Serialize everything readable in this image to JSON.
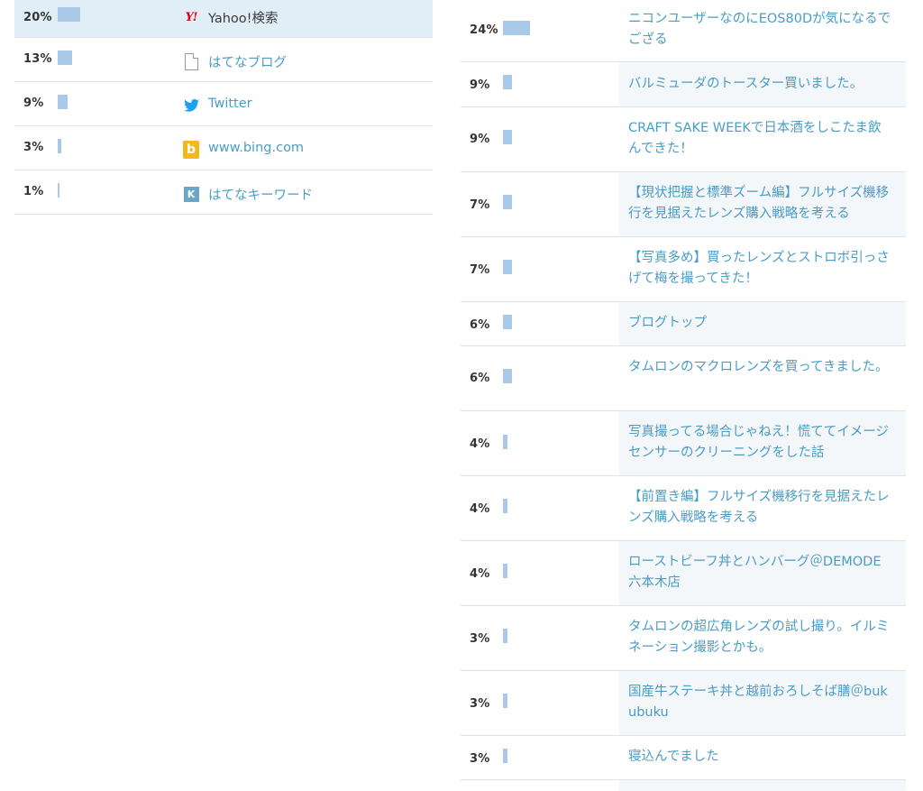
{
  "referrers": [
    {
      "percent": "20%",
      "share": 20,
      "label": "Yahoo!検索",
      "icon": "yahoo-icon",
      "highlighted": true
    },
    {
      "percent": "13%",
      "share": 13,
      "label": "はてなブログ",
      "icon": "document-icon"
    },
    {
      "percent": "9%",
      "share": 9,
      "label": "Twitter",
      "icon": "twitter-bird-icon"
    },
    {
      "percent": "3%",
      "share": 3,
      "label": "www.bing.com",
      "icon": "bing-icon"
    },
    {
      "percent": "1%",
      "share": 1,
      "label": "はてなキーワード",
      "icon": "hatena-keyword-icon"
    }
  ],
  "pages": [
    {
      "percent": "24%",
      "share": 24,
      "title": "ニコンユーザーなのにEOS80Dが気になるでござる"
    },
    {
      "percent": "9%",
      "share": 9,
      "title": "バルミューダのトースター買いました。"
    },
    {
      "percent": "9%",
      "share": 9,
      "title": "CRAFT SAKE WEEKで日本酒をしこたま飲んできた！"
    },
    {
      "percent": "7%",
      "share": 7,
      "title": "【現状把握と標準ズーム編】フルサイズ機移行を見据えたレンズ購入戦略を考える"
    },
    {
      "percent": "7%",
      "share": 7,
      "title": "【写真多め】買ったレンズとストロボ引っさげて梅を撮ってきた！"
    },
    {
      "percent": "6%",
      "share": 6,
      "title": "ブログトップ"
    },
    {
      "percent": "6%",
      "share": 6,
      "title": "タムロンのマクロレンズを買ってきました。"
    },
    {
      "percent": "4%",
      "share": 4,
      "title": "写真撮ってる場合じゃねえ！慌ててイメージセンサーのクリーニングをした話"
    },
    {
      "percent": "4%",
      "share": 4,
      "title": "【前置き編】フルサイズ機移行を見据えたレンズ購入戦略を考える"
    },
    {
      "percent": "4%",
      "share": 4,
      "title": "ローストビーフ丼とハンバーグ＠DEMODE 六本木店"
    },
    {
      "percent": "3%",
      "share": 3,
      "title": "タムロンの超広角レンズの試し撮り。イルミネーション撮影とかも。"
    },
    {
      "percent": "3%",
      "share": 3,
      "title": "国産牛ステーキ丼と越前おろしそば膳＠bukubuku"
    },
    {
      "percent": "3%",
      "share": 3,
      "title": "寝込んでました"
    }
  ],
  "colors": {
    "bar": "#a9c9e8",
    "link": "#4a9cc4",
    "highlight": "#e1eef7"
  }
}
